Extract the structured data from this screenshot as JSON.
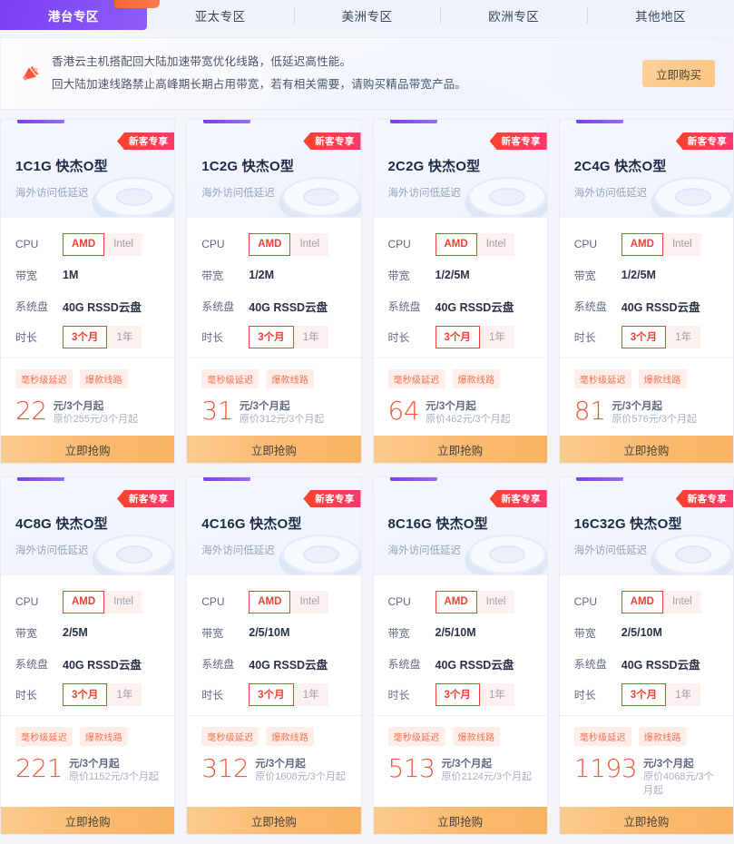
{
  "tabs": [
    {
      "label": "港台专区",
      "active": true
    },
    {
      "label": "亚太专区",
      "active": false
    },
    {
      "label": "美洲专区",
      "active": false
    },
    {
      "label": "欧洲专区",
      "active": false
    },
    {
      "label": "其他地区",
      "active": false
    }
  ],
  "notice": {
    "icon": "megaphone-icon",
    "line1": "香港云主机搭配回大陆加速带宽优化线路，低延迟高性能。",
    "line2": "回大陆加速线路禁止高峰期长期占用带宽，若有相关需要，请购买精品带宽产品。",
    "button_label": "立即购买"
  },
  "labels": {
    "cpu": "CPU",
    "bandwidth": "带宽",
    "disk": "系统盘",
    "duration": "时长",
    "badge": "新客专享",
    "buy": "立即抢购"
  },
  "colors": {
    "accent_purple": "#7b3ff2",
    "badge_red": "#f8442b",
    "badge_pink": "#fb3a6e",
    "price_red": "#f4573d",
    "select_red": "#f04134",
    "button_orange": "#fabb72"
  },
  "cards": [
    {
      "title": "1C1G 快杰O型",
      "subtitle": "海外访问低延迟",
      "badge": "新客专享",
      "cpu_options": [
        "AMD",
        "Intel"
      ],
      "cpu_selected": "AMD",
      "bandwidth": "1M",
      "disk": "40G RSSD云盘",
      "duration_options": [
        "3个月",
        "1年"
      ],
      "duration_selected": "3个月",
      "tags": [
        "毫秒级延迟",
        "爆款线路"
      ],
      "price": "22",
      "price_unit": "元/3个月起",
      "original_price": "原价255元/3个月起",
      "buy_label": "立即抢购"
    },
    {
      "title": "1C2G 快杰O型",
      "subtitle": "海外访问低延迟",
      "badge": "新客专享",
      "cpu_options": [
        "AMD",
        "Intel"
      ],
      "cpu_selected": "AMD",
      "bandwidth": "1/2M",
      "disk": "40G RSSD云盘",
      "duration_options": [
        "3个月",
        "1年"
      ],
      "duration_selected": "3个月",
      "tags": [
        "毫秒级延迟",
        "爆款线路"
      ],
      "price": "31",
      "price_unit": "元/3个月起",
      "original_price": "原价312元/3个月起",
      "buy_label": "立即抢购"
    },
    {
      "title": "2C2G 快杰O型",
      "subtitle": "海外访问低延迟",
      "badge": "新客专享",
      "cpu_options": [
        "AMD",
        "Intel"
      ],
      "cpu_selected": "AMD",
      "bandwidth": "1/2/5M",
      "disk": "40G RSSD云盘",
      "duration_options": [
        "3个月",
        "1年"
      ],
      "duration_selected": "3个月",
      "tags": [
        "毫秒级延迟",
        "爆款线路"
      ],
      "price": "64",
      "price_unit": "元/3个月起",
      "original_price": "原价462元/3个月起",
      "buy_label": "立即抢购"
    },
    {
      "title": "2C4G 快杰O型",
      "subtitle": "海外访问低延迟",
      "badge": "新客专享",
      "cpu_options": [
        "AMD",
        "Intel"
      ],
      "cpu_selected": "AMD",
      "bandwidth": "1/2/5M",
      "disk": "40G RSSD云盘",
      "duration_options": [
        "3个月",
        "1年"
      ],
      "duration_selected": "3个月",
      "tags": [
        "毫秒级延迟",
        "爆款线路"
      ],
      "price": "81",
      "price_unit": "元/3个月起",
      "original_price": "原价576元/3个月起",
      "buy_label": "立即抢购"
    },
    {
      "title": "4C8G 快杰O型",
      "subtitle": "海外访问低延迟",
      "badge": "新客专享",
      "cpu_options": [
        "AMD",
        "Intel"
      ],
      "cpu_selected": "AMD",
      "bandwidth": "2/5M",
      "disk": "40G RSSD云盘",
      "duration_options": [
        "3个月",
        "1年"
      ],
      "duration_selected": "3个月",
      "tags": [
        "毫秒级延迟",
        "爆款线路"
      ],
      "price": "221",
      "price_unit": "元/3个月起",
      "original_price": "原价1152元/3个月起",
      "buy_label": "立即抢购"
    },
    {
      "title": "4C16G 快杰O型",
      "subtitle": "海外访问低延迟",
      "badge": "新客专享",
      "cpu_options": [
        "AMD",
        "Intel"
      ],
      "cpu_selected": "AMD",
      "bandwidth": "2/5/10M",
      "disk": "40G RSSD云盘",
      "duration_options": [
        "3个月",
        "1年"
      ],
      "duration_selected": "3个月",
      "tags": [
        "毫秒级延迟",
        "爆款线路"
      ],
      "price": "312",
      "price_unit": "元/3个月起",
      "original_price": "原价1608元/3个月起",
      "buy_label": "立即抢购"
    },
    {
      "title": "8C16G 快杰O型",
      "subtitle": "海外访问低延迟",
      "badge": "新客专享",
      "cpu_options": [
        "AMD",
        "Intel"
      ],
      "cpu_selected": "AMD",
      "bandwidth": "2/5/10M",
      "disk": "40G RSSD云盘",
      "duration_options": [
        "3个月",
        "1年"
      ],
      "duration_selected": "3个月",
      "tags": [
        "毫秒级延迟",
        "爆款线路"
      ],
      "price": "513",
      "price_unit": "元/3个月起",
      "original_price": "原价2124元/3个月起",
      "buy_label": "立即抢购"
    },
    {
      "title": "16C32G 快杰O型",
      "subtitle": "海外访问低延迟",
      "badge": "新客专享",
      "cpu_options": [
        "AMD",
        "Intel"
      ],
      "cpu_selected": "AMD",
      "bandwidth": "2/5/10M",
      "disk": "40G RSSD云盘",
      "duration_options": [
        "3个月",
        "1年"
      ],
      "duration_selected": "3个月",
      "tags": [
        "毫秒级延迟",
        "爆款线路"
      ],
      "price": "1193",
      "price_unit": "元/3个月起",
      "original_price": "原价4068元/3个月起",
      "buy_label": "立即抢购"
    }
  ]
}
